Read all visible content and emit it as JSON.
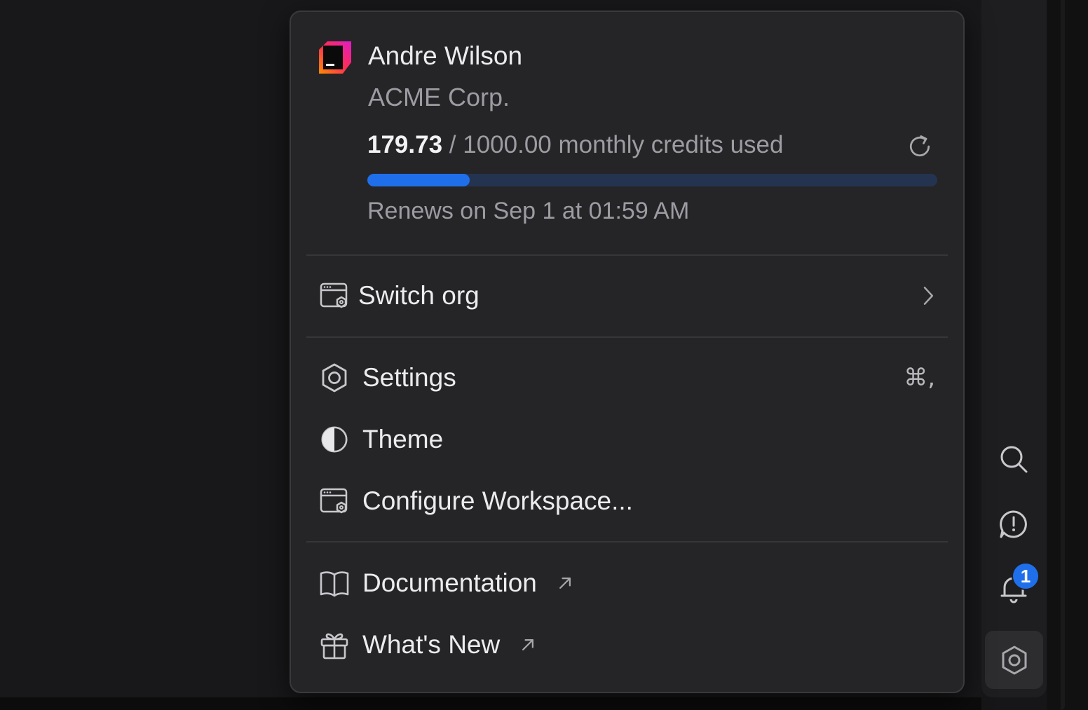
{
  "user": {
    "name": "Andre Wilson",
    "org": "ACME Corp."
  },
  "credits": {
    "used": "179.73",
    "suffix": "/ 1000.00 monthly credits used",
    "used_value": 179.73,
    "total_value": 1000.0,
    "renews": "Renews on Sep 1 at 01:59 AM"
  },
  "menu": {
    "switch_org": "Switch org",
    "settings": "Settings",
    "settings_shortcut": "⌘,",
    "theme": "Theme",
    "configure_workspace": "Configure Workspace...",
    "documentation": "Documentation",
    "whats_new": "What's New"
  },
  "rail": {
    "notifications_count": "1"
  },
  "colors": {
    "accent": "#1f6feb",
    "menu_bg": "#252527",
    "text_muted": "#9c9ca2"
  },
  "icons": {
    "logo": "jetbrains-logo",
    "refresh": "refresh-icon",
    "switch_org": "workspace-gear-icon",
    "settings": "hexagon-settings-icon",
    "theme": "half-circle-icon",
    "configure": "workspace-gear-icon",
    "documentation": "book-icon",
    "whats_new": "gift-icon",
    "external": "arrow-up-right-icon",
    "chevron": "chevron-right-icon"
  }
}
